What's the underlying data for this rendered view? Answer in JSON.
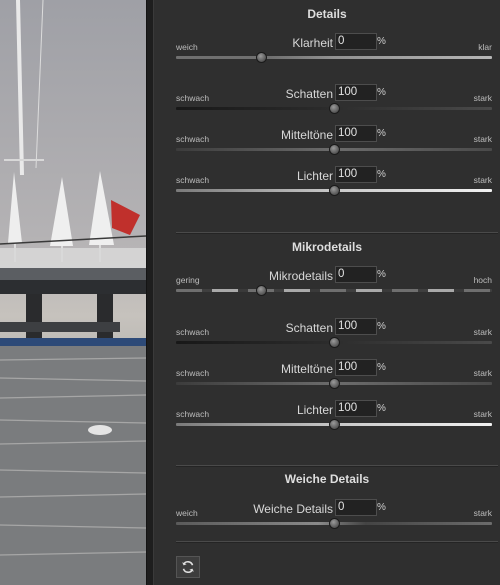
{
  "sections": [
    {
      "title": "Details",
      "rows": [
        {
          "left": "weich",
          "name": "Klarheit",
          "value": "0",
          "unit": "%",
          "right": "klar",
          "level": 0.27
        },
        {
          "left": "schwach",
          "name": "Schatten",
          "value": "100",
          "unit": "%",
          "right": "stark",
          "level": 0.5
        },
        {
          "left": "schwach",
          "name": "Mitteltöne",
          "value": "100",
          "unit": "%",
          "right": "stark",
          "level": 0.5
        },
        {
          "left": "schwach",
          "name": "Lichter",
          "value": "100",
          "unit": "%",
          "right": "stark",
          "level": 0.5
        }
      ]
    },
    {
      "title": "Mikrodetails",
      "rows": [
        {
          "left": "gering",
          "name": "Mikrodetails",
          "value": "0",
          "unit": "%",
          "right": "hoch",
          "level": 0.27
        },
        {
          "left": "schwach",
          "name": "Schatten",
          "value": "100",
          "unit": "%",
          "right": "stark",
          "level": 0.5
        },
        {
          "left": "schwach",
          "name": "Mitteltöne",
          "value": "100",
          "unit": "%",
          "right": "stark",
          "level": 0.5
        },
        {
          "left": "schwach",
          "name": "Lichter",
          "value": "100",
          "unit": "%",
          "right": "stark",
          "level": 0.5
        }
      ]
    },
    {
      "title": "Weiche Details",
      "rows": [
        {
          "left": "weich",
          "name": "Weiche Details",
          "value": "0",
          "unit": "%",
          "right": "stark",
          "level": 0.5
        }
      ]
    }
  ],
  "footer": {
    "reset_icon": "refresh-icon"
  }
}
